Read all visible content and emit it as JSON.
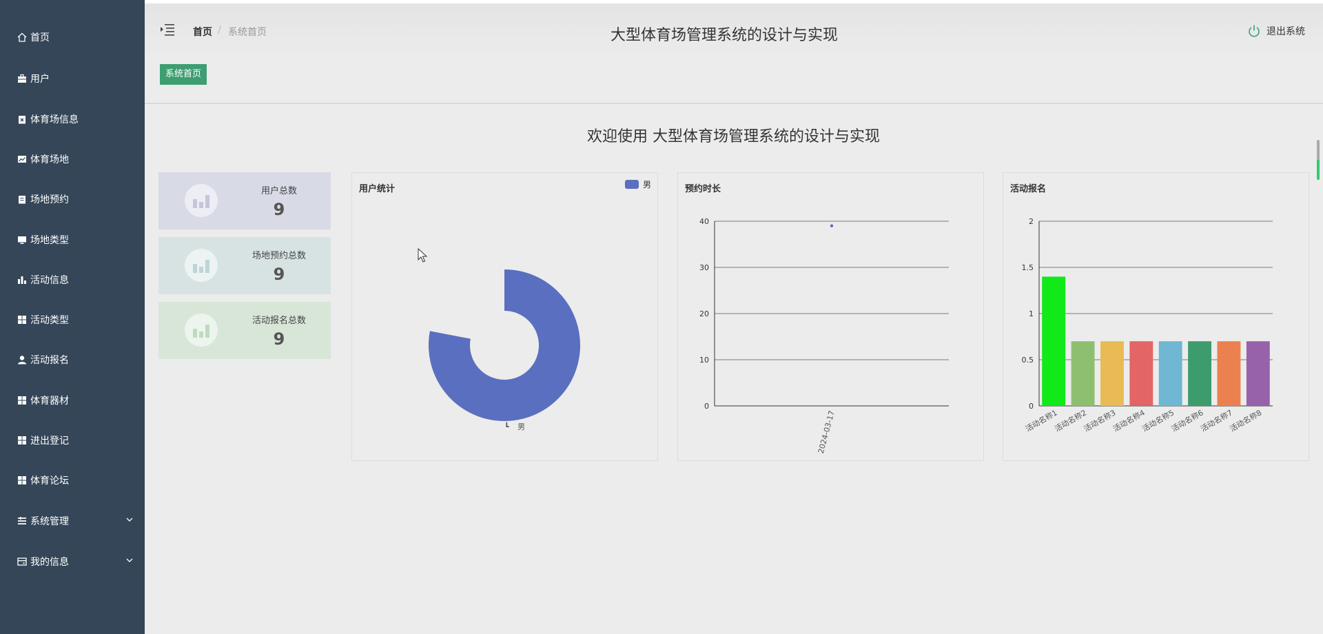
{
  "sidebar": {
    "items": [
      {
        "label": "首页",
        "icon": "home-icon"
      },
      {
        "label": "用户",
        "icon": "briefcase-icon"
      },
      {
        "label": "体育场信息",
        "icon": "clipboard-x-icon"
      },
      {
        "label": "体育场地",
        "icon": "line-chart-icon"
      },
      {
        "label": "场地预约",
        "icon": "clipboard-icon"
      },
      {
        "label": "场地类型",
        "icon": "monitor-icon"
      },
      {
        "label": "活动信息",
        "icon": "bar-chart-icon"
      },
      {
        "label": "活动类型",
        "icon": "grid-icon"
      },
      {
        "label": "活动报名",
        "icon": "user-icon"
      },
      {
        "label": "体育器材",
        "icon": "grid-icon"
      },
      {
        "label": "进出登记",
        "icon": "grid-icon"
      },
      {
        "label": "体育论坛",
        "icon": "grid-icon"
      },
      {
        "label": "系统管理",
        "icon": "list-icon",
        "expandable": true
      },
      {
        "label": "我的信息",
        "icon": "card-icon",
        "expandable": true
      }
    ]
  },
  "header": {
    "breadcrumb_home": "首页",
    "breadcrumb_sep": "/",
    "breadcrumb_current": "系统首页",
    "title": "大型体育场管理系统的设计与实现",
    "logout_label": "退出系统"
  },
  "tags": {
    "active": "系统首页"
  },
  "welcome": "欢迎使用 大型体育场管理系统的设计与实现",
  "stats": [
    {
      "label": "用户总数",
      "value": "9",
      "bg": "#d8dae6",
      "icon_color": "#c3c6dc"
    },
    {
      "label": "场地预约总数",
      "value": "9",
      "bg": "#d7e3e3",
      "icon_color": "#bcd6d6"
    },
    {
      "label": "活动报名总数",
      "value": "9",
      "bg": "#d8e6d8",
      "icon_color": "#bddbbf"
    }
  ],
  "colors": {
    "sidebar": "#344658",
    "accent": "#3d9e72",
    "pie": "#5a6fbf"
  },
  "chart_data": [
    {
      "type": "pie",
      "title": "用户统计",
      "legend": [
        "男"
      ],
      "legend_position": "top-right",
      "slices": [
        {
          "name": "男",
          "value": 1,
          "color": "#5a6fbf"
        }
      ],
      "rose": true,
      "label_mark": "┗"
    },
    {
      "type": "scatter",
      "title": "预约时长",
      "x": [
        "2024-03-17"
      ],
      "values": [
        39
      ],
      "ylim": [
        0,
        40
      ],
      "yticks": [
        0,
        10,
        20,
        30,
        40
      ],
      "grid": true,
      "color": "#5a6fbf"
    },
    {
      "type": "bar",
      "title": "活动报名",
      "categories": [
        "活动名称1",
        "活动名称2",
        "活动名称3",
        "活动名称4",
        "活动名称5",
        "活动名称6",
        "活动名称7",
        "活动名称8"
      ],
      "values": [
        1.4,
        0.7,
        0.7,
        0.7,
        0.7,
        0.7,
        0.7,
        0.7
      ],
      "colors": [
        "#11e919",
        "#8ebf71",
        "#e9bb55",
        "#e36565",
        "#6fb7d2",
        "#3d9c6c",
        "#ec8150",
        "#9862ab"
      ],
      "ylim": [
        0,
        2
      ],
      "yticks": [
        "0",
        "0.5",
        "1",
        "1.5",
        "2"
      ],
      "grid": true
    }
  ]
}
